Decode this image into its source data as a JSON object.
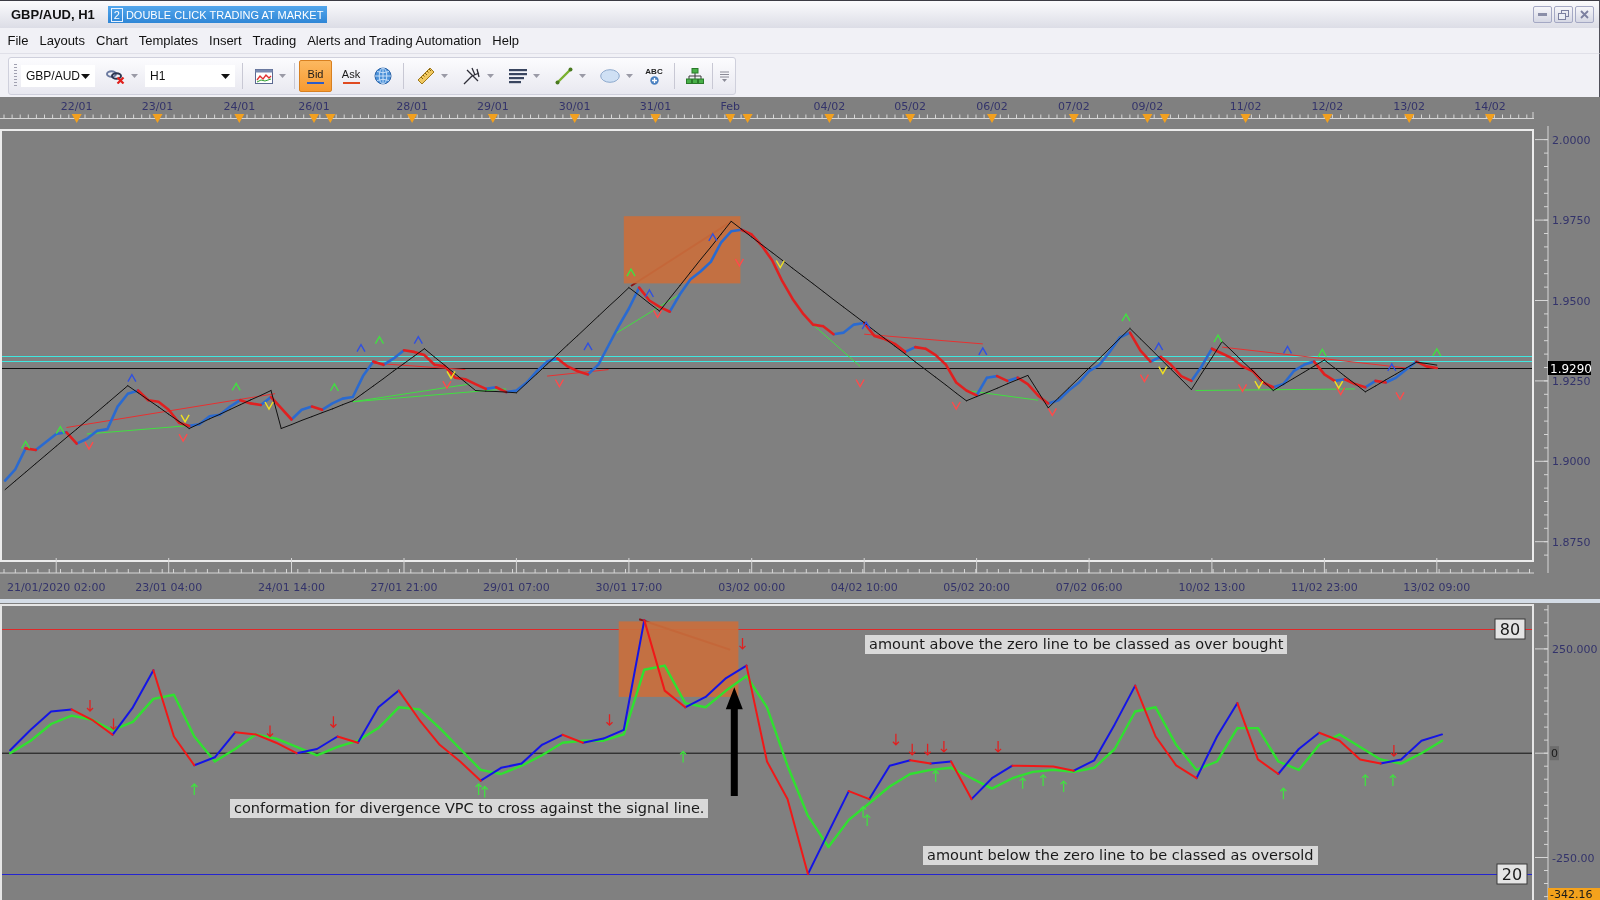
{
  "window": {
    "title": "GBP/AUD, H1",
    "mode_badge": {
      "number": "2",
      "label": "DOUBLE CLICK TRADING AT MARKET"
    }
  },
  "menu": [
    "File",
    "Layouts",
    "Chart",
    "Templates",
    "Insert",
    "Trading",
    "Alerts and Trading Automation",
    "Help"
  ],
  "toolbar": {
    "symbol": "GBP/AUD",
    "timeframe": "H1",
    "price_sides": [
      {
        "label": "Bid",
        "selected": true,
        "color": "#2c5cc8"
      },
      {
        "label": "Ask",
        "selected": false,
        "color": "#e04a20"
      }
    ],
    "text_tool": "ABC"
  },
  "date_scale": [
    "22/01",
    "23/01",
    "24/01",
    "26/01",
    "28/01",
    "29/01",
    "30/01",
    "31/01",
    "Feb",
    "04/02",
    "05/02",
    "06/02",
    "07/02",
    "09/02",
    "11/02",
    "12/02",
    "13/02",
    "14/02"
  ],
  "price_chart": {
    "current_price": "1.9290",
    "chart_data": {
      "type": "line",
      "categories": [
        null,
        null,
        null,
        null,
        null,
        "21/01/2020 02:00",
        null,
        null,
        null,
        null,
        null,
        null,
        null,
        null,
        null,
        null,
        "23/01 04:00",
        null,
        null,
        null,
        null,
        null,
        null,
        null,
        null,
        null,
        null,
        null,
        "24/01 14:00",
        null,
        null,
        null,
        null,
        null,
        null,
        null,
        null,
        null,
        null,
        "27/01 21:00",
        null,
        null,
        null,
        null,
        null,
        null,
        null,
        null,
        null,
        null,
        "29/01 07:00",
        null,
        null,
        null,
        null,
        null,
        null,
        null,
        null,
        null,
        null,
        "30/01 17:00",
        null,
        null,
        null,
        null,
        null,
        null,
        null,
        null,
        null,
        null,
        null,
        "03/02 00:00",
        null,
        null,
        null,
        null,
        null,
        null,
        null,
        null,
        null,
        null,
        "04/02 10:00",
        null,
        null,
        null,
        null,
        null,
        null,
        null,
        null,
        null,
        null,
        "05/02 20:00",
        null,
        null,
        null,
        null,
        null,
        null,
        null,
        null,
        null,
        null,
        "07/02 06:00",
        null,
        null,
        null,
        null,
        null,
        null,
        null,
        null,
        null,
        null,
        null,
        "10/02 13:00",
        null,
        null,
        null,
        null,
        null,
        null,
        null,
        null,
        null,
        null,
        "11/02 23:00",
        null,
        null,
        null,
        null,
        null,
        null,
        null,
        null,
        null,
        null,
        "13/02 09:00",
        null,
        null,
        null,
        null,
        null,
        null,
        null,
        null,
        null
      ],
      "ylim": [
        1.869,
        2.003
      ],
      "yticks": [
        {
          "value": 2,
          "label": "2.0000"
        },
        {
          "value": 1.975,
          "label": "1.9750"
        },
        {
          "value": 1.95,
          "label": "1.9500"
        },
        {
          "value": 1.925,
          "label": "1.9250"
        },
        {
          "value": 1.9,
          "label": "1.9000"
        },
        {
          "value": 1.875,
          "label": "1.8750"
        }
      ],
      "series": [
        {
          "color": "#2a6ad0",
          "values": [
            1.894,
            1.8975,
            1.904,
            1.9035,
            1.906,
            1.9085,
            1.909,
            1.9055,
            1.907,
            1.9095,
            1.91,
            1.917,
            1.921,
            1.922,
            null,
            null,
            null,
            null,
            1.911,
            1.9115,
            1.914,
            1.9145,
            1.917,
            1.919,
            null,
            1.9175,
            1.92,
            null,
            1.913,
            1.916,
            1.917,
            1.916,
            1.918,
            1.9195,
            1.92,
            1.9265,
            1.931,
            1.93,
            1.932,
            1.9345,
            null,
            null,
            null,
            null,
            null,
            null,
            null,
            1.9225,
            1.923,
            1.9215,
            1.922,
            1.9245,
            1.928,
            1.931,
            1.932,
            null,
            null,
            1.927,
            1.93,
            1.936,
            1.942,
            1.9475,
            1.954,
            null,
            null,
            1.9465,
            1.952,
            1.9565,
            1.959,
            1.962,
            1.968,
            1.9715,
            1.972,
            null,
            null,
            null,
            null,
            null,
            null,
            null,
            null,
            1.9395,
            1.94,
            1.9425,
            1.943,
            null,
            null,
            null,
            1.934,
            1.9355,
            null,
            null,
            null,
            null,
            null,
            1.9205,
            1.926,
            1.9265,
            1.925,
            1.926,
            null,
            null,
            1.918,
            1.919,
            1.922,
            1.9245,
            1.928,
            1.93,
            1.934,
            1.9385,
            1.94,
            null,
            1.931,
            1.9325,
            null,
            null,
            1.925,
            1.9295,
            1.935,
            null,
            null,
            null,
            null,
            null,
            1.923,
            1.924,
            1.928,
            1.93,
            1.931,
            null,
            1.925,
            1.9255,
            null,
            1.923,
            1.925,
            1.9245,
            1.926,
            1.9285,
            1.931,
            null,
            null,
            null,
            null,
            null,
            null,
            null,
            null,
            null,
            null,
            null
          ]
        },
        {
          "color": "#e02020",
          "values": [
            null,
            null,
            1.904,
            1.9035,
            null,
            null,
            1.909,
            1.9055,
            null,
            null,
            null,
            null,
            null,
            1.922,
            1.919,
            1.9185,
            1.916,
            1.912,
            1.911,
            null,
            null,
            null,
            null,
            1.919,
            1.918,
            1.9175,
            1.92,
            1.9165,
            1.913,
            null,
            1.917,
            1.916,
            null,
            null,
            null,
            null,
            1.931,
            1.93,
            null,
            1.9345,
            1.934,
            1.933,
            1.93,
            1.9295,
            1.926,
            1.9255,
            1.924,
            1.9225,
            1.923,
            1.9215,
            null,
            null,
            null,
            null,
            1.932,
            1.9295,
            1.928,
            1.927,
            null,
            null,
            null,
            null,
            1.954,
            1.95,
            1.948,
            1.9465,
            null,
            null,
            null,
            null,
            null,
            null,
            1.972,
            1.9705,
            1.967,
            1.9625,
            1.956,
            1.9505,
            1.946,
            1.9425,
            1.942,
            1.9395,
            null,
            null,
            1.943,
            1.939,
            1.938,
            1.9365,
            1.934,
            1.9355,
            1.935,
            1.933,
            1.93,
            1.9245,
            1.922,
            1.9205,
            null,
            1.9265,
            1.925,
            1.926,
            1.924,
            1.9205,
            1.918,
            null,
            null,
            null,
            null,
            null,
            null,
            null,
            1.94,
            1.9345,
            1.931,
            1.9325,
            1.93,
            1.9265,
            1.925,
            null,
            1.935,
            1.9335,
            1.932,
            1.9295,
            1.928,
            1.9245,
            1.923,
            null,
            null,
            null,
            1.931,
            1.927,
            1.925,
            1.9255,
            1.924,
            1.923,
            1.925,
            1.9245,
            null,
            null,
            1.931,
            1.9295,
            1.929,
            null,
            null,
            null,
            null,
            null,
            null,
            null,
            null,
            null
          ]
        },
        {
          "color": "#111111",
          "values": [
            1.8912,
            1.8939,
            1.8966,
            1.8993,
            1.902,
            1.9047,
            1.9074,
            1.91,
            1.9127,
            1.9154,
            1.9181,
            1.9208,
            1.9235,
            1.9213,
            1.9191,
            1.9169,
            1.9146,
            1.9124,
            1.9102,
            1.9117,
            1.9132,
            1.9146,
            1.9161,
            1.9176,
            1.9191,
            1.9205,
            1.922,
            1.9102,
            1.9114,
            1.9127,
            1.9139,
            1.9151,
            1.9163,
            1.9176,
            1.9188,
            1.9211,
            1.9234,
            1.9257,
            1.9281,
            1.9304,
            1.9327,
            1.935,
            1.9324,
            1.9298,
            1.9272,
            1.9246,
            1.922,
            1.9218,
            1.9217,
            1.9215,
            1.9213,
            1.9243,
            1.9272,
            1.9302,
            1.9332,
            1.9362,
            1.9391,
            1.9421,
            1.9451,
            1.9481,
            1.951,
            1.954,
            1.9516,
            1.9491,
            1.9467,
            1.9507,
            1.9547,
            1.9587,
            1.9627,
            1.9666,
            1.9706,
            1.9746,
            1.9722,
            1.9697,
            1.9673,
            1.9649,
            1.9625,
            1.96,
            1.9576,
            1.9552,
            1.9528,
            1.9503,
            1.9479,
            1.9455,
            1.9431,
            1.9406,
            1.9382,
            1.9358,
            1.9334,
            1.9309,
            1.9285,
            1.9261,
            1.9237,
            1.9212,
            1.9188,
            1.9201,
            1.9214,
            1.9227,
            1.9241,
            1.9254,
            1.9267,
            1.9217,
            1.9166,
            1.9197,
            1.9228,
            1.9259,
            1.929,
            1.932,
            1.9351,
            1.9382,
            1.9413,
            1.9381,
            1.935,
            1.9318,
            1.9286,
            1.9255,
            1.9223,
            1.9273,
            1.9322,
            1.9372,
            1.9342,
            1.9311,
            1.9281,
            1.925,
            1.922,
            1.9239,
            1.9258,
            1.9277,
            1.9296,
            1.9315,
            1.929,
            1.9265,
            1.9241,
            1.9216,
            1.9234,
            1.9253,
            1.9271,
            1.929,
            1.9308,
            1.9304,
            1.9299,
            null,
            null,
            null,
            null,
            null,
            null,
            null,
            null,
            null
          ]
        }
      ]
    }
  },
  "oscillator": {
    "scale_low_label": "-342.16",
    "levels": [
      {
        "label": "80",
        "color": "#e02828"
      },
      {
        "label": "20",
        "color": "#2424d0"
      }
    ],
    "chart_data": {
      "type": "line",
      "categories": [
        null,
        null,
        null,
        null,
        null,
        null,
        null,
        null,
        null,
        null,
        null,
        null,
        null,
        null,
        null,
        null,
        null,
        null,
        null,
        null,
        null,
        null,
        null,
        null,
        null,
        null,
        null,
        null,
        null,
        null,
        null,
        null,
        null,
        null,
        null,
        null,
        null,
        null,
        null,
        null,
        null,
        null,
        null,
        null,
        null,
        null,
        null,
        null,
        null,
        null,
        null,
        null,
        null,
        null,
        null,
        null,
        null,
        null,
        null,
        null,
        null,
        null,
        null,
        null,
        null,
        null,
        null,
        null,
        null,
        null,
        null,
        null,
        null,
        null,
        null
      ],
      "ylim": [
        -352,
        360
      ],
      "yticks": [
        {
          "value": 250,
          "label": "250.000"
        },
        {
          "value": 0,
          "label": "0"
        },
        {
          "value": -250,
          "label": "-250.00"
        }
      ],
      "series": [
        {
          "color": "#1414e6",
          "values": [
            7,
            56,
            100,
            105,
            null,
            44,
            110,
            199,
            null,
            -29,
            -10,
            50,
            null,
            null,
            0,
            10,
            40,
            25,
            110,
            150,
            null,
            null,
            null,
            -66,
            -35,
            -25,
            20,
            44,
            25,
            35,
            56,
            319,
            null,
            110,
            135,
            180,
            210,
            null,
            null,
            -290,
            -190,
            -91,
            -110,
            -30,
            -17,
            -25,
            -20,
            -110,
            -60,
            -30,
            null,
            null,
            -42,
            -17,
            69,
            162,
            null,
            null,
            -60,
            40,
            120,
            null,
            -50,
            10,
            49,
            null,
            null,
            -25,
            -15,
            30,
            45,
            null,
            null,
            null,
            null
          ]
        },
        {
          "color": "#30e030",
          "values": [
            0,
            30,
            70,
            90,
            80,
            55,
            75,
            130,
            140,
            40,
            -20,
            10,
            45,
            35,
            15,
            -5,
            15,
            30,
            60,
            110,
            105,
            60,
            10,
            -40,
            -50,
            -30,
            -5,
            25,
            30,
            30,
            45,
            200,
            210,
            120,
            110,
            150,
            185,
            110,
            -30,
            -150,
            -225,
            -160,
            -120,
            -80,
            -50,
            -40,
            -35,
            -60,
            -85,
            -60,
            -45,
            -40,
            -45,
            -35,
            10,
            100,
            110,
            20,
            -40,
            -20,
            60,
            60,
            -20,
            -40,
            20,
            45,
            15,
            -15,
            -25,
            0,
            30,
            null,
            null,
            null,
            null
          ]
        },
        {
          "color": "#f01818",
          "values": [
            null,
            null,
            null,
            105,
            80,
            44,
            null,
            199,
            40,
            -29,
            null,
            50,
            45,
            25,
            0,
            null,
            40,
            25,
            null,
            150,
            80,
            20,
            -20,
            -66,
            null,
            null,
            null,
            44,
            25,
            null,
            null,
            319,
            150,
            110,
            null,
            null,
            210,
            -20,
            -110,
            -290,
            null,
            -91,
            -110,
            null,
            -17,
            -25,
            -20,
            -110,
            null,
            -30,
            -31,
            -32,
            -42,
            null,
            null,
            162,
            40,
            -29,
            -60,
            null,
            120,
            -15,
            -50,
            null,
            49,
            30,
            -15,
            -25,
            null,
            null,
            null,
            null,
            null,
            null,
            null
          ]
        }
      ],
      "annotations": [
        {
          "text": "amount above the zero line to be classed as over bought"
        },
        {
          "text": "conformation for divergence VPC to cross against the signal line."
        },
        {
          "text": "amount below the zero line to be classed as oversold"
        }
      ]
    }
  }
}
